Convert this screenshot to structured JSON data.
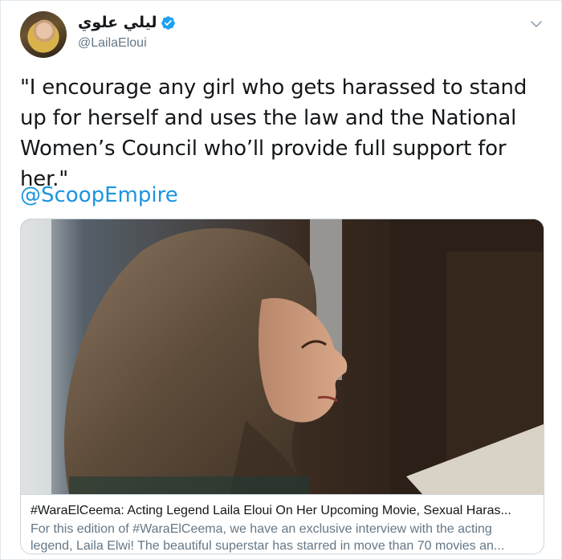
{
  "tweet": {
    "author": {
      "display_name": "ليلي علوي",
      "handle": "@LailaEloui",
      "verified": true,
      "avatar_icon": "profile-photo"
    },
    "menu_icon": "chevron-down-icon",
    "text": "\"I encourage any girl who gets harassed to stand up for herself and uses the law and the National Women’s Council who’ll provide full support for her.\"",
    "mention": "@ScoopEmpire"
  },
  "card": {
    "image_icon": "article-photo",
    "title": "#WaraElCeema: Acting Legend Laila Eloui On Her Upcoming Movie, Sexual Haras...",
    "description": "For this edition of #WaraElCeema, we have an exclusive interview with the acting legend, Laila Elwi! The beautiful superstar has starred in move than 70 movies an..."
  },
  "colors": {
    "link": "#1b95e0",
    "secondary_text": "#657786",
    "primary_text": "#14171a",
    "border": "#ccd6dd"
  }
}
